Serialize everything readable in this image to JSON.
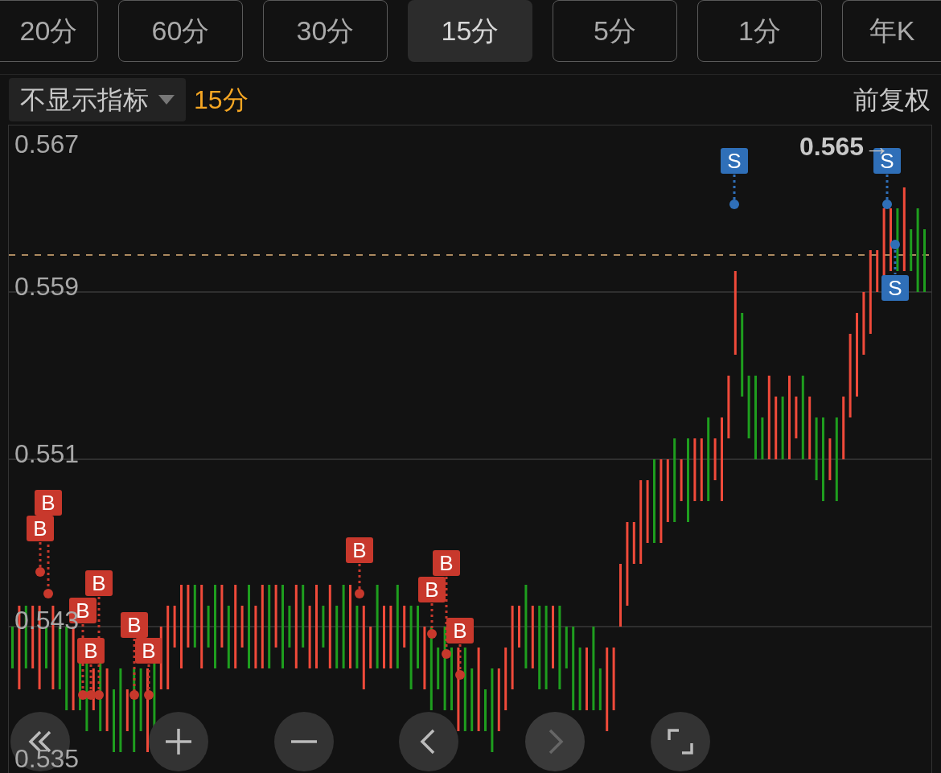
{
  "period_tabs": [
    {
      "label": "20分",
      "selected": false
    },
    {
      "label": "60分",
      "selected": false
    },
    {
      "label": "30分",
      "selected": false
    },
    {
      "label": "15分",
      "selected": true
    },
    {
      "label": "5分",
      "selected": false
    },
    {
      "label": "1分",
      "selected": false
    },
    {
      "label": "年K",
      "selected": false
    }
  ],
  "indicator_dropdown": {
    "value": "不显示指标"
  },
  "period_label": "15分",
  "adjustment": "前复权",
  "chart": {
    "y_labels": [
      "0.567",
      "0.559",
      "0.551",
      "0.543",
      "0.535"
    ],
    "latest_price_label": "0.565→",
    "markers": [
      {
        "label": "B",
        "kind": "buy"
      },
      {
        "label": "B",
        "kind": "buy"
      },
      {
        "label": "B",
        "kind": "buy"
      },
      {
        "label": "B",
        "kind": "buy"
      },
      {
        "label": "B",
        "kind": "buy"
      },
      {
        "label": "B",
        "kind": "buy"
      },
      {
        "label": "B",
        "kind": "buy"
      },
      {
        "label": "B",
        "kind": "buy"
      },
      {
        "label": "B",
        "kind": "buy"
      },
      {
        "label": "B",
        "kind": "buy"
      },
      {
        "label": "B",
        "kind": "buy"
      },
      {
        "label": "S",
        "kind": "sell"
      },
      {
        "label": "S",
        "kind": "sell"
      },
      {
        "label": "S",
        "kind": "sell"
      }
    ]
  },
  "controls": [
    {
      "kind": "fast-back",
      "disabled": false
    },
    {
      "kind": "zoom-in",
      "disabled": false
    },
    {
      "kind": "zoom-out",
      "disabled": false
    },
    {
      "kind": "back",
      "disabled": false
    },
    {
      "kind": "forward",
      "disabled": true
    },
    {
      "kind": "fullscreen",
      "disabled": false
    }
  ]
}
